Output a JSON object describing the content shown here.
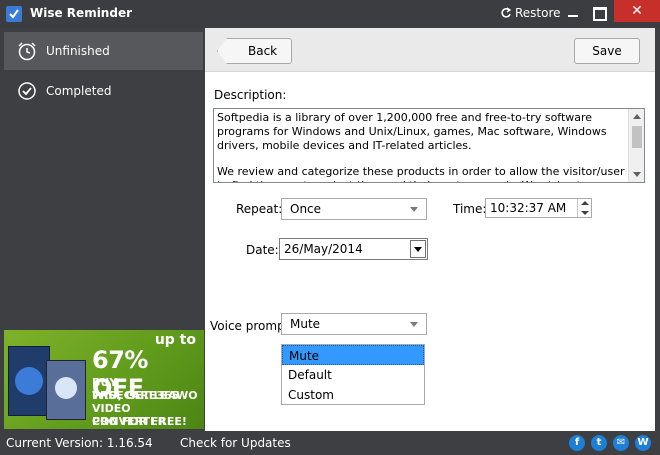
{
  "window": {
    "title": "Wise Reminder",
    "restore_label": "Restore",
    "close_glyph": "✕",
    "accent_color": "#3a7bd5",
    "close_color": "#c7302a"
  },
  "sidebar": {
    "items": [
      {
        "label": "Unfinished",
        "icon": "alarm-clock-icon",
        "active": true
      },
      {
        "label": "Completed",
        "icon": "check-circle-icon",
        "active": false
      }
    ]
  },
  "ad": {
    "up_to": "up to",
    "percent": "67% OFF",
    "lines": [
      "BUY WISECARE365",
      "PRO, GET LEAWO",
      "VIDEO CONVERTER",
      "PRO FOR FREE!"
    ]
  },
  "toolbar": {
    "back_label": "Back",
    "save_label": "Save"
  },
  "form": {
    "description_label": "Description:",
    "description_paragraphs": [
      "Softpedia is a library of over 1,200,000 free and free-to-try software programs for Windows and Unix/Linux, games, Mac software, Windows drivers, mobile devices and IT-related articles.",
      "We review and categorize these products in order to allow the visitor/user to find the exact product they and their system needs. We strive to deliver only the best"
    ],
    "repeat_label": "Repeat:",
    "repeat_value": "Once",
    "time_label": "Time:",
    "time_value": "10:32:37 AM",
    "date_label": "Date:",
    "date_value": "26/May/2014",
    "voice_label": "Voice prompts",
    "voice_value": "Mute",
    "voice_options": [
      "Mute",
      "Default",
      "Custom"
    ],
    "voice_selected_index": 0
  },
  "status": {
    "version": "Current Version: 1.16.54",
    "check_updates": "Check for Updates",
    "social": [
      {
        "icon": "facebook-icon",
        "glyph": "f"
      },
      {
        "icon": "twitter-icon",
        "glyph": "t"
      },
      {
        "icon": "email-icon",
        "glyph": "✉"
      },
      {
        "icon": "wisecleaner-icon",
        "glyph": "W"
      }
    ]
  }
}
